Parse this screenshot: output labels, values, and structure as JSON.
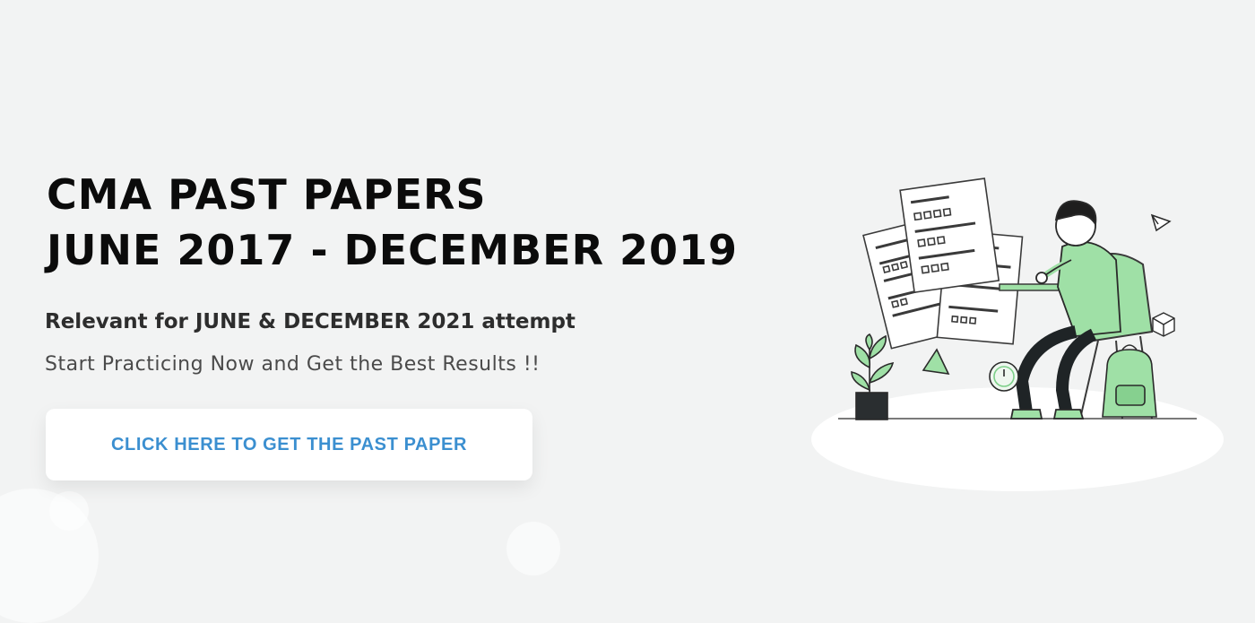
{
  "hero": {
    "title_line1": "CMA PAST PAPERS",
    "title_line2": "JUNE 2017 - DECEMBER 2019",
    "subtitle": "Relevant for JUNE & DECEMBER 2021 attempt",
    "tagline": "Start Practicing Now and Get the Best Results !!"
  },
  "cta": {
    "label": "CLICK HERE TO GET THE PAST PAPER"
  },
  "colors": {
    "background": "#f2f3f3",
    "accent_green": "#8fdc9b",
    "button_text": "#3b8fd0",
    "title_text": "#0b0b0b"
  },
  "illustration": {
    "icons": [
      "student-studying-icon",
      "exam-papers-icon",
      "plant-pot-icon",
      "backpack-icon",
      "clock-icon",
      "paper-plane-icon",
      "cube-icon",
      "triangle-icon"
    ]
  }
}
